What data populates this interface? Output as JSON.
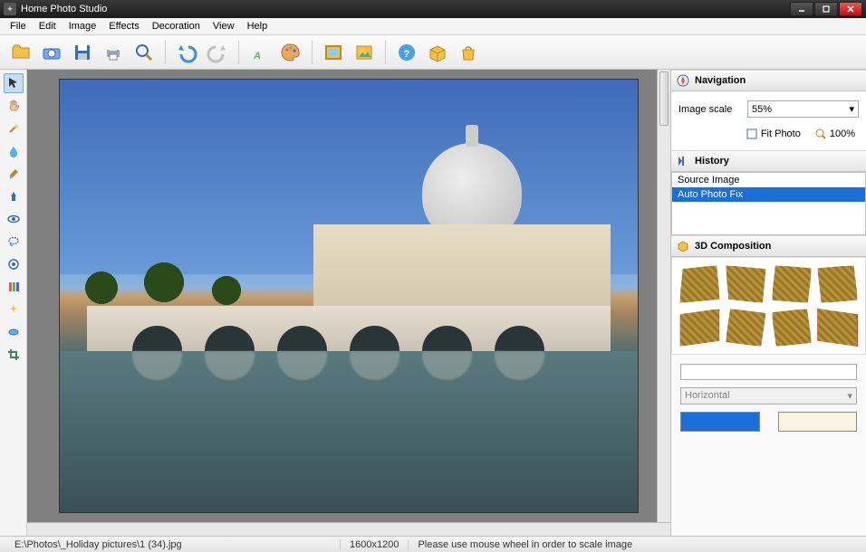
{
  "window": {
    "title": "Home Photo Studio"
  },
  "menu": {
    "items": [
      "File",
      "Edit",
      "Image",
      "Effects",
      "Decoration",
      "View",
      "Help"
    ]
  },
  "toolbar": {
    "buttons": [
      "open",
      "camera",
      "save",
      "print",
      "zoom",
      "undo",
      "redo",
      "text",
      "palette",
      "frame",
      "picture",
      "help",
      "box",
      "bag"
    ]
  },
  "tools": [
    "pointer",
    "hand",
    "wand",
    "drop",
    "brush",
    "clone",
    "eye",
    "lasso",
    "target",
    "levels",
    "color",
    "erase",
    "crop"
  ],
  "nav": {
    "title": "Navigation",
    "scale_label": "Image scale",
    "scale_value": "55%",
    "fit_label": "Fit Photo",
    "hundred_label": "100%"
  },
  "history": {
    "title": "History",
    "items": [
      "Source Image",
      "Auto Photo Fix"
    ],
    "selected": 1
  },
  "composition": {
    "title": "3D Composition",
    "orientation": "Horizontal",
    "color1": "#1a6fd8",
    "color2": "#f8f5e0"
  },
  "status": {
    "path": "E:\\Photos\\_Holiday pictures\\1 (34).jpg",
    "dimensions": "1600x1200",
    "hint": "Please use mouse wheel in order to scale image"
  }
}
